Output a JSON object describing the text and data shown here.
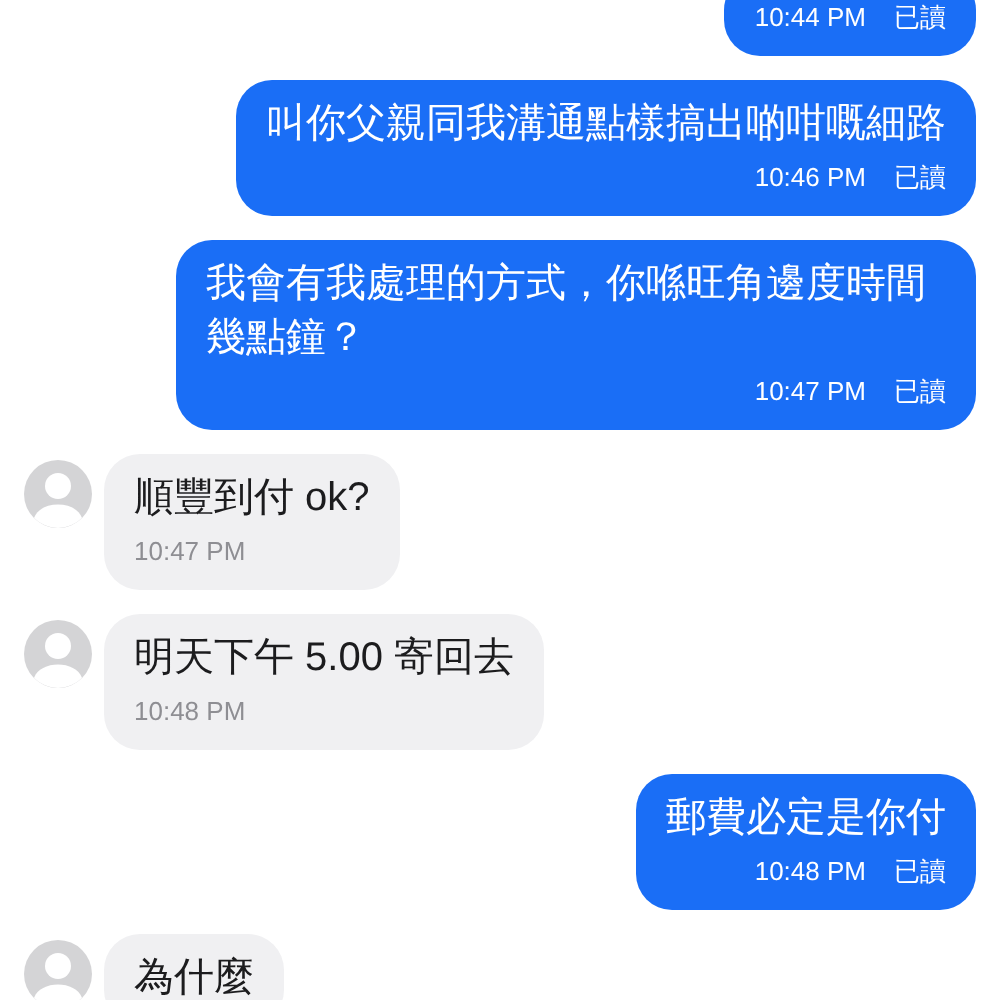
{
  "messages": [
    {
      "kind": "sent",
      "time": "10:44 PM",
      "status": "已讀"
    },
    {
      "kind": "sent",
      "text": "叫你父親同我溝通點樣搞出啲咁嘅細路",
      "time": "10:46 PM",
      "status": "已讀"
    },
    {
      "kind": "sent",
      "text": "我會有我處理的方式，你喺旺角邊度時間幾點鐘？",
      "time": "10:47 PM",
      "status": "已讀"
    },
    {
      "kind": "received",
      "text": "順豐到付 ok?",
      "time": "10:47 PM"
    },
    {
      "kind": "received",
      "text": "明天下午 5.00 寄回去",
      "time": "10:48 PM"
    },
    {
      "kind": "sent",
      "text": "郵費必定是你付",
      "time": "10:48 PM",
      "status": "已讀"
    },
    {
      "kind": "received",
      "text": "為什麼"
    }
  ]
}
